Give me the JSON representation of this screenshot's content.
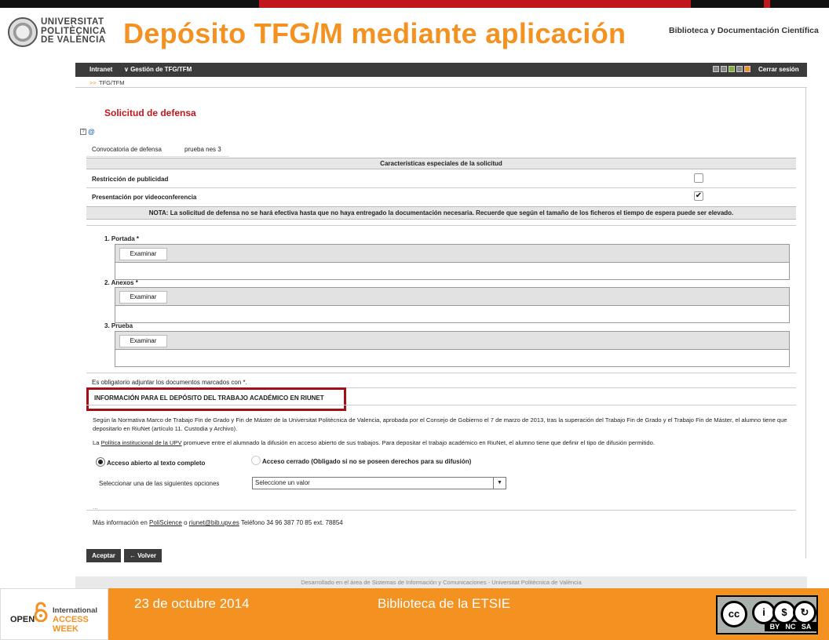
{
  "slide": {
    "title": "Depósito TFG/M mediante aplicación",
    "university": [
      "UNIVERSITAT",
      "POLITÈCNICA",
      "DE VALÈNCIA"
    ],
    "department": "Biblioteca y Documentación Científica",
    "date": "23 de octubre 2014",
    "library": "Biblioteca de la ETSIE",
    "oa_logo": {
      "open": "OPEN",
      "line1": "International",
      "line2": "ACCESS WEEK"
    },
    "cc_license": {
      "badges": [
        "cc",
        "BY",
        "NC",
        "SA"
      ],
      "label": "BY NC SA"
    }
  },
  "navbar": {
    "intranet": "Intranet",
    "gestion": "Gestión de TFG/TFM",
    "logout": "Cerrar sesión"
  },
  "breadcrumb": {
    "arrow": ">>",
    "item": "TFG/TFM"
  },
  "form": {
    "heading": "Solicitud de defensa",
    "convocatoria_label": "Convocatoria de defensa",
    "convocatoria_value": "prueba nes 3",
    "caracteristicas_header": "Características especiales de la solicitud",
    "restriccion_label": "Restricción de publicidad",
    "restriccion_checked": false,
    "videoconf_label": "Presentación por videoconferencia",
    "videoconf_checked": true,
    "nota": "NOTA: La solicitud de defensa no se hará efectiva hasta que no haya entregado la documentación necesaria. Recuerde que según el tamaño de los ficheros el tiempo de espera puede ser elevado.",
    "files": [
      {
        "num": "1.",
        "label": "Portada *",
        "button": "Examinar"
      },
      {
        "num": "2.",
        "label": "Anexos *",
        "button": "Examinar"
      },
      {
        "num": "3.",
        "label": "Prueba",
        "button": "Examinar"
      }
    ],
    "obligatorio": "Es obligatorio adjuntar los documentos marcados con *."
  },
  "riunet": {
    "title": "INFORMACIÓN PARA EL DEPÓSITO DEL TRABAJO ACADÉMICO EN RIUNET",
    "para1": "Según la Normativa Marco de Trabajo Fin de Grado y Fin de Máster de la Universitat Politècnica de Valencia, aprobada por el Consejo de Gobierno el 7 de marzo de 2013, tras la superación del Trabajo Fin de Grado y el Trabajo Fin de Máster, el alumno tiene que depositarlo en RiuNet (artículo 11. Custodia y Archivo).",
    "para2_pre": "La ",
    "para2_link": "Política institucional de la UPV",
    "para2_post": " promueve entre el alumnado la difusión en acceso abierto de sus trabajos. Para depositar el trabajo académico en RiuNet, el alumno tiene que definir el tipo de difusión permitido.",
    "radio_open": "Acceso abierto al texto completo",
    "radio_closed": "Acceso cerrado (Obligado si no se poseen derechos para su difusión)",
    "select_label": "Seleccionar una de las siguientes opciones",
    "select_value": "Seleccione un valor",
    "ellipsis": "...",
    "more_pre": "Más información en ",
    "more_link1": "PoliScience",
    "more_mid": " o ",
    "more_link2": "riunet@bib.upv.es",
    "more_post": " Teléfono 34 96 387 70 85 ext. 78854"
  },
  "buttons": {
    "accept": "Aceptar",
    "back": "← Volver"
  },
  "footer": "Desarrollado en el área de Sistemas de Información y Comunicaciones - Universitat Politècnica de València",
  "colors": {
    "orange": "#f39221",
    "red": "#c0161c",
    "dark": "#3b3b3b"
  }
}
